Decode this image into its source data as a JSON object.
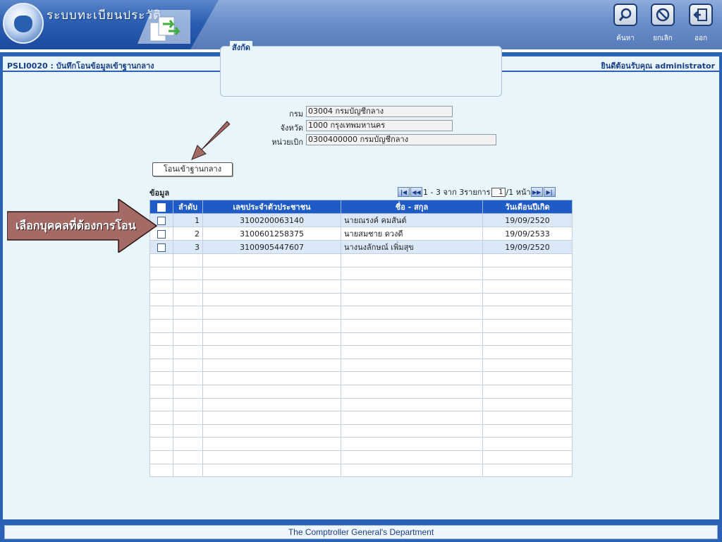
{
  "header": {
    "app_title": "ระบบทะเบียนประวัติ",
    "buttons": [
      {
        "label": "ค้นหา",
        "icon": "search-icon"
      },
      {
        "label": "ยกเลิก",
        "icon": "cancel-icon"
      },
      {
        "label": "ออก",
        "icon": "exit-icon"
      }
    ]
  },
  "page": {
    "title": "PSLI0020 : บันทึกโอนข้อมูลเข้าฐานกลาง",
    "welcome": "ยินดีต้อนรับคุณ administrator"
  },
  "affiliation": {
    "legend": "สังกัด",
    "fields": [
      {
        "label": "กรม",
        "value": "03004 กรมบัญชีกลาง"
      },
      {
        "label": "จังหวัด",
        "value": "1000 กรุงเทพมหานคร"
      },
      {
        "label": "หน่วยเบิก",
        "value": "0300400000 กรมบัญชีกลาง"
      }
    ]
  },
  "transfer_button": "โอนเข้าฐานกลาง",
  "grid": {
    "data_label": "ข้อมูล",
    "pager": {
      "range_text": "1 - 3 จาก 3รายการ",
      "page_value": "1",
      "page_total_text": "/1 หน้า"
    },
    "columns": [
      "ลำดับ",
      "เลขประจำตัวประชาชน",
      "ชื่อ - สกุล",
      "วันเดือนปีเกิด"
    ],
    "rows": [
      {
        "no": "1",
        "id": "3100200063140",
        "name": "นายณรงค์ คมสันต์",
        "dob": "19/09/2520"
      },
      {
        "no": "2",
        "id": "3100601258375",
        "name": "นายสมชาย ดวงดี",
        "dob": "19/09/2533"
      },
      {
        "no": "3",
        "id": "3100905447607",
        "name": "นางนงลักษณ์ เพิ่มสุข",
        "dob": "19/09/2520"
      }
    ]
  },
  "callout": "เลือกบุคคลที่ต้องการโอน",
  "footer": "The Comptroller General's Department",
  "colors": {
    "brand_blue": "#2b61b6",
    "header_row": "#1e5bc6",
    "row_highlight": "#dbe8f8",
    "callout_fill": "#a36a66"
  }
}
